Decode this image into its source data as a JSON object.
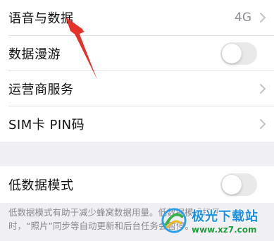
{
  "settings": {
    "rows": [
      {
        "label": "语音与数据",
        "value": "4G"
      },
      {
        "label": "数据漫游"
      },
      {
        "label": "运营商服务"
      },
      {
        "label": "SIM卡 PIN码"
      }
    ],
    "low_data": {
      "label": "低数据模式",
      "toggle_on": false,
      "footer_line1": "低数据模式有助于减少蜂窝数据用量。低数据模式打开",
      "footer_line2": "时，“照片”同步等自动更新和后台任务会暂停。"
    },
    "roaming_toggle_on": false
  },
  "watermark": {
    "name": "极光下载站",
    "url": "www.xz7.com"
  },
  "colors": {
    "annotation_arrow": "#e4322b",
    "background": "#efeff4",
    "toggle_off": "#e9e9ea"
  }
}
